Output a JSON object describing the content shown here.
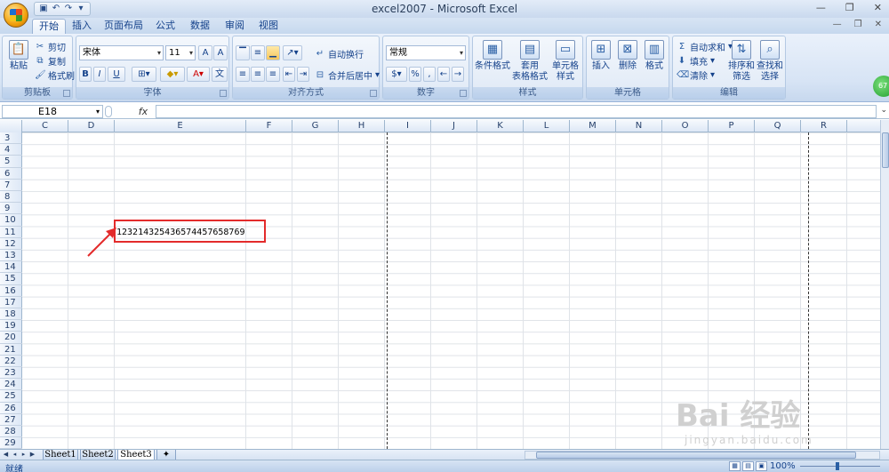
{
  "window": {
    "title": "excel2007 - Microsoft Excel"
  },
  "tabs": [
    "开始",
    "插入",
    "页面布局",
    "公式",
    "数据",
    "审阅",
    "视图"
  ],
  "ribbon": {
    "clipboard": {
      "label": "剪贴板",
      "paste": "粘贴",
      "cut": "剪切",
      "copy": "复制",
      "format_painter": "格式刷"
    },
    "font": {
      "label": "字体",
      "family": "宋体",
      "size": "11",
      "bold": "B",
      "italic": "I",
      "underline": "U"
    },
    "alignment": {
      "label": "对齐方式",
      "wrap": "自动换行",
      "merge": "合并后居中"
    },
    "number": {
      "label": "数字",
      "format": "常规",
      "percent": "%"
    },
    "styles": {
      "label": "样式",
      "conditional": "条件格式",
      "table_format_1": "套用",
      "table_format_2": "表格格式",
      "cell_styles_1": "单元格",
      "cell_styles_2": "样式"
    },
    "cells": {
      "label": "单元格",
      "insert": "插入",
      "delete": "删除",
      "format": "格式"
    },
    "editing": {
      "label": "编辑",
      "autosum": "自动求和",
      "fill": "填充",
      "clear": "清除",
      "sort_1": "排序和",
      "sort_2": "筛选",
      "find_1": "查找和",
      "find_2": "选择"
    }
  },
  "formula_bar": {
    "name_box": "E18",
    "fx": "fx",
    "value": ""
  },
  "columns": [
    "C",
    "D",
    "E",
    "F",
    "G",
    "H",
    "I",
    "J",
    "K",
    "L",
    "M",
    "N",
    "O",
    "P",
    "Q",
    "R"
  ],
  "rows": [
    "3",
    "4",
    "5",
    "6",
    "7",
    "8",
    "9",
    "10",
    "11",
    "12",
    "13",
    "14",
    "15",
    "16",
    "17",
    "18",
    "19",
    "20",
    "21",
    "22",
    "23",
    "24",
    "25",
    "26",
    "27",
    "28",
    "29"
  ],
  "cell_content": {
    "ref": "E11",
    "value": "123214325436574457658769"
  },
  "sheets": [
    "Sheet1",
    "Sheet2",
    "Sheet3"
  ],
  "active_sheet": "Sheet3",
  "status": {
    "text": "就绪",
    "zoom": "100%"
  },
  "badge": "67",
  "watermark": {
    "main": "Bai 经验",
    "sub": "jingyan.baidu.com"
  }
}
